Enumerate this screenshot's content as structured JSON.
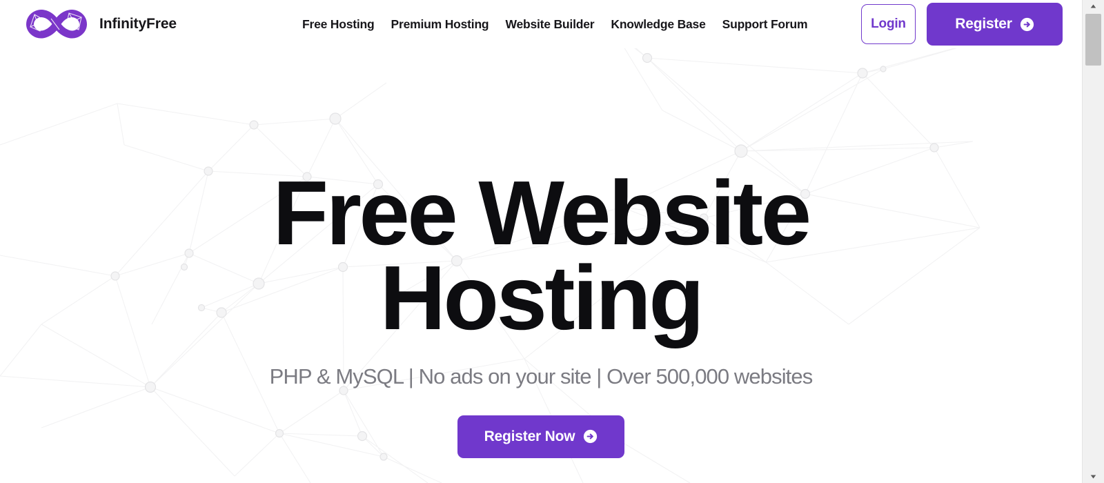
{
  "colors": {
    "brand_purple": "#7038cc",
    "headline": "#0d0d10",
    "subtitle": "#7b7b82",
    "nav_text": "#17161a",
    "page_background": "#ffffff",
    "constellation_node": "#ededee",
    "constellation_line": "#f2f2f3",
    "scrollbar_track": "#f1f1f1",
    "scrollbar_thumb": "#c1c1c1"
  },
  "header": {
    "brand": {
      "name": "InfinityFree",
      "logo_icon": "infinity-logo-icon"
    },
    "nav": [
      {
        "label": "Free Hosting"
      },
      {
        "label": "Premium Hosting"
      },
      {
        "label": "Website Builder"
      },
      {
        "label": "Knowledge Base"
      },
      {
        "label": "Support Forum"
      }
    ],
    "actions": {
      "login_label": "Login",
      "register_label": "Register",
      "register_icon": "arrow-right-circle-icon"
    }
  },
  "hero": {
    "title_line1": "Free Website",
    "title_line2": "Hosting",
    "subtitle": "PHP & MySQL | No ads on your site | Over 500,000 websites",
    "cta_label": "Register Now",
    "cta_icon": "arrow-right-circle-icon",
    "background_pattern": "network-constellation-pattern"
  },
  "scrollbar": {
    "up_arrow_icon": "scroll-up-arrow-icon",
    "down_arrow_icon": "scroll-down-arrow-icon",
    "position": "top"
  }
}
